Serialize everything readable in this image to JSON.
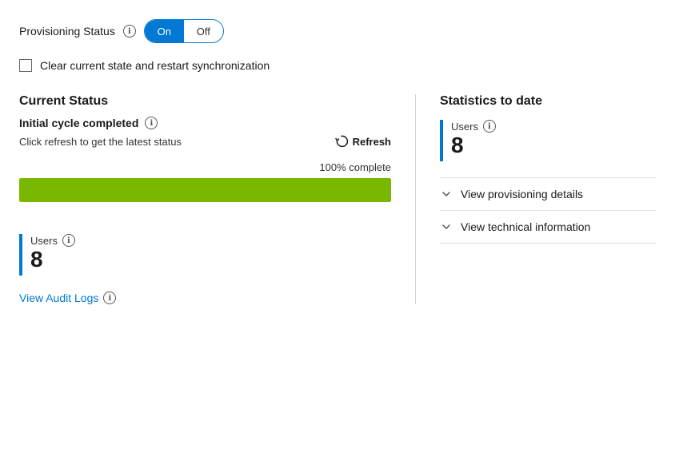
{
  "provisioning_status": {
    "label": "Provisioning Status",
    "info_icon": "ℹ",
    "toggle_on_label": "On",
    "toggle_off_label": "Off",
    "active": "on"
  },
  "checkbox": {
    "label": "Clear current state and restart synchronization",
    "checked": false
  },
  "current_status": {
    "title": "Current Status",
    "cycle_label": "Initial cycle completed",
    "refresh_text": "Click refresh to get the latest status",
    "refresh_button_label": "Refresh",
    "progress_percent": "100% complete",
    "progress_value": 100
  },
  "left_stats": {
    "users_label": "Users",
    "users_count": "8",
    "view_audit_label": "View Audit Logs"
  },
  "right_panel": {
    "title": "Statistics to date",
    "users_label": "Users",
    "users_count": "8",
    "expandable_items": [
      {
        "label": "View provisioning details"
      },
      {
        "label": "View technical information"
      }
    ]
  },
  "icons": {
    "info": "ℹ",
    "chevron_down": "∨"
  }
}
